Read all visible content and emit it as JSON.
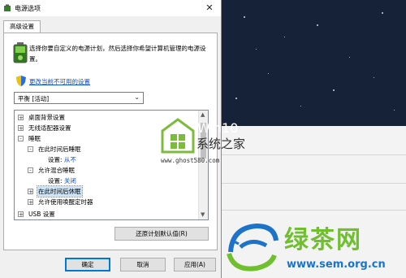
{
  "window": {
    "title": "电源选项",
    "close_glyph": "✕"
  },
  "tab": {
    "label": "高级设置"
  },
  "description": "选择你要自定义的电源计划，然后选择你希望计算机管理的电源设置。",
  "change_link": "更改当前不可用的设置",
  "plan_select": {
    "value": "平衡 [活动]"
  },
  "tree": {
    "items": [
      {
        "label": "桌面背景设置",
        "toggle": "+"
      },
      {
        "label": "无线适配器设置",
        "toggle": "+"
      },
      {
        "label": "睡眠",
        "toggle": "-"
      },
      {
        "label": "在此时间后睡眠",
        "toggle": "-"
      },
      {
        "label": "设置:",
        "value": "从不"
      },
      {
        "label": "允许混合睡眠",
        "toggle": "-"
      },
      {
        "label": "设置:",
        "value": "关闭"
      },
      {
        "label": "在此时间后休眠",
        "toggle": "+"
      },
      {
        "label": "允许使用唤醒定时器",
        "toggle": "+"
      },
      {
        "label": "USB 设置",
        "toggle": "+"
      }
    ]
  },
  "buttons": {
    "restore": "还原计划默认值(R)",
    "ok": "确定",
    "cancel": "取消",
    "apply": "应用(A)"
  },
  "watermark1": {
    "brand": "Win10",
    "cn": "系统之家",
    "url": "www.ghost580.com"
  },
  "watermark2": {
    "cn": "绿茶网",
    "url": "www.sem.org.cn"
  }
}
